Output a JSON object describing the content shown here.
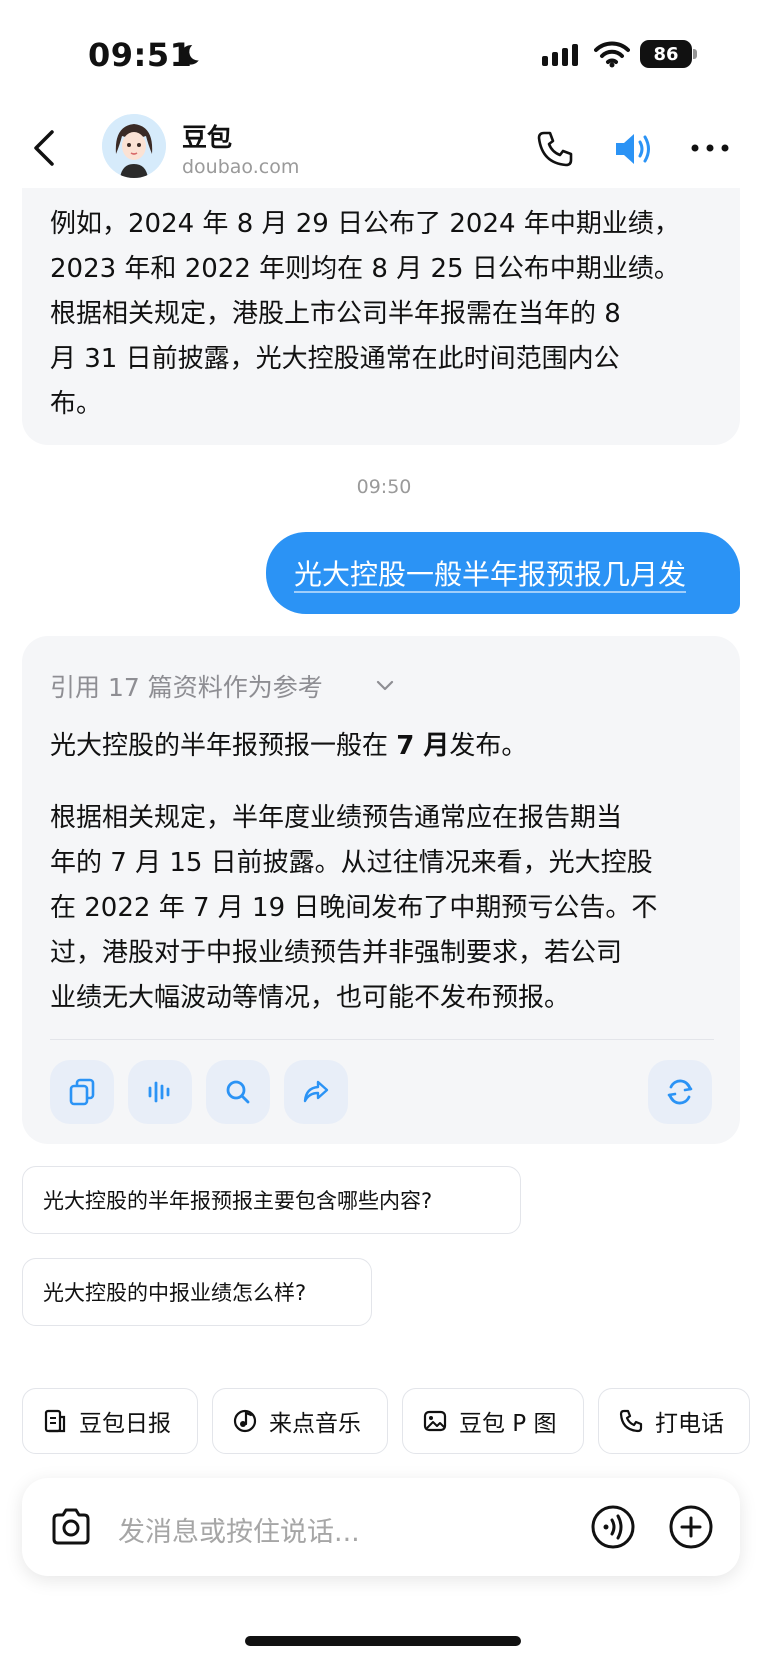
{
  "status_bar": {
    "time": "09:51",
    "battery": "86"
  },
  "header": {
    "name": "豆包",
    "domain": "doubao.com"
  },
  "previous_reply": {
    "lines": [
      "例如，2024 年 8 月 29 日公布了 2024 年中期业绩，",
      "2023 年和 2022 年则均在 8 月 25 日公布中期业绩。",
      "根据相关规定，港股上市公司半年报需在当年的 8",
      "月 31 日前披露，光大控股通常在此时间范围内公",
      "布。"
    ]
  },
  "timestamp": "09:50",
  "user_message": "光大控股一般半年报预报几月发",
  "reply": {
    "references": "引用 17 篇资料作为参考",
    "p1_before": "光大控股的半年报预报一般在 ",
    "p1_bold": "7 月",
    "p1_after": "发布。",
    "p2_lines": [
      "根据相关规定，半年度业绩预告通常应在报告期当",
      "年的 7 月 15 日前披露。从过往情况来看，光大控股",
      "在 2022 年 7 月 19 日晚间发布了中期预亏公告。不",
      "过，港股对于中报业绩预告并非强制要求，若公司",
      "业绩无大幅波动等情况，也可能不发布预报。"
    ]
  },
  "suggestions": [
    "光大控股的半年报预报主要包含哪些内容?",
    "光大控股的中报业绩怎么样?"
  ],
  "quick_actions": [
    {
      "label": "豆包日报",
      "icon": "document-icon"
    },
    {
      "label": "来点音乐",
      "icon": "music-icon"
    },
    {
      "label": "豆包 P 图",
      "icon": "image-edit-icon"
    },
    {
      "label": "打电话",
      "icon": "phone-icon"
    }
  ],
  "input": {
    "placeholder": "发消息或按住说话..."
  },
  "colors": {
    "accent": "#2b93f5",
    "bubble_bg": "#f5f6f8",
    "muted": "#9a9a9a"
  }
}
